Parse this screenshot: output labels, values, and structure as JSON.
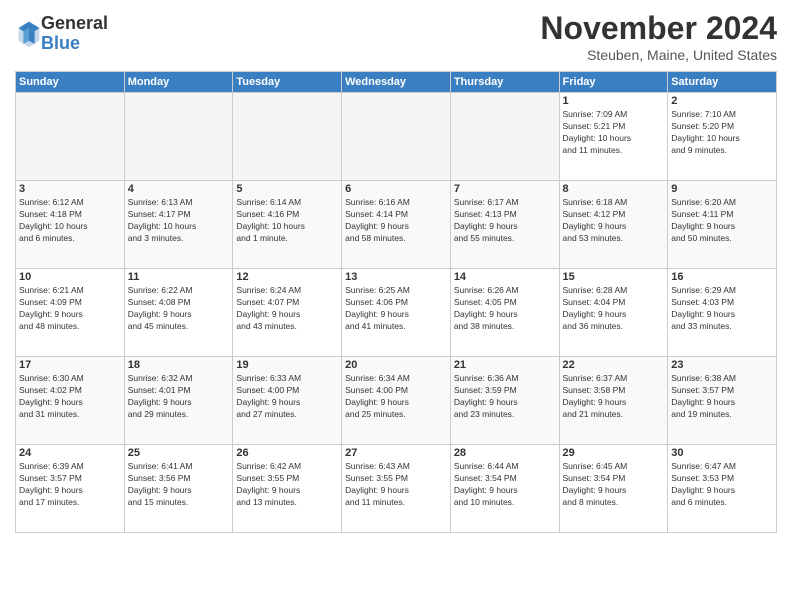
{
  "logo": {
    "general": "General",
    "blue": "Blue"
  },
  "title": "November 2024",
  "location": "Steuben, Maine, United States",
  "days_header": [
    "Sunday",
    "Monday",
    "Tuesday",
    "Wednesday",
    "Thursday",
    "Friday",
    "Saturday"
  ],
  "weeks": [
    [
      {
        "day": "",
        "info": ""
      },
      {
        "day": "",
        "info": ""
      },
      {
        "day": "",
        "info": ""
      },
      {
        "day": "",
        "info": ""
      },
      {
        "day": "",
        "info": ""
      },
      {
        "day": "1",
        "info": "Sunrise: 7:09 AM\nSunset: 5:21 PM\nDaylight: 10 hours\nand 11 minutes."
      },
      {
        "day": "2",
        "info": "Sunrise: 7:10 AM\nSunset: 5:20 PM\nDaylight: 10 hours\nand 9 minutes."
      }
    ],
    [
      {
        "day": "3",
        "info": "Sunrise: 6:12 AM\nSunset: 4:18 PM\nDaylight: 10 hours\nand 6 minutes."
      },
      {
        "day": "4",
        "info": "Sunrise: 6:13 AM\nSunset: 4:17 PM\nDaylight: 10 hours\nand 3 minutes."
      },
      {
        "day": "5",
        "info": "Sunrise: 6:14 AM\nSunset: 4:16 PM\nDaylight: 10 hours\nand 1 minute."
      },
      {
        "day": "6",
        "info": "Sunrise: 6:16 AM\nSunset: 4:14 PM\nDaylight: 9 hours\nand 58 minutes."
      },
      {
        "day": "7",
        "info": "Sunrise: 6:17 AM\nSunset: 4:13 PM\nDaylight: 9 hours\nand 55 minutes."
      },
      {
        "day": "8",
        "info": "Sunrise: 6:18 AM\nSunset: 4:12 PM\nDaylight: 9 hours\nand 53 minutes."
      },
      {
        "day": "9",
        "info": "Sunrise: 6:20 AM\nSunset: 4:11 PM\nDaylight: 9 hours\nand 50 minutes."
      }
    ],
    [
      {
        "day": "10",
        "info": "Sunrise: 6:21 AM\nSunset: 4:09 PM\nDaylight: 9 hours\nand 48 minutes."
      },
      {
        "day": "11",
        "info": "Sunrise: 6:22 AM\nSunset: 4:08 PM\nDaylight: 9 hours\nand 45 minutes."
      },
      {
        "day": "12",
        "info": "Sunrise: 6:24 AM\nSunset: 4:07 PM\nDaylight: 9 hours\nand 43 minutes."
      },
      {
        "day": "13",
        "info": "Sunrise: 6:25 AM\nSunset: 4:06 PM\nDaylight: 9 hours\nand 41 minutes."
      },
      {
        "day": "14",
        "info": "Sunrise: 6:26 AM\nSunset: 4:05 PM\nDaylight: 9 hours\nand 38 minutes."
      },
      {
        "day": "15",
        "info": "Sunrise: 6:28 AM\nSunset: 4:04 PM\nDaylight: 9 hours\nand 36 minutes."
      },
      {
        "day": "16",
        "info": "Sunrise: 6:29 AM\nSunset: 4:03 PM\nDaylight: 9 hours\nand 33 minutes."
      }
    ],
    [
      {
        "day": "17",
        "info": "Sunrise: 6:30 AM\nSunset: 4:02 PM\nDaylight: 9 hours\nand 31 minutes."
      },
      {
        "day": "18",
        "info": "Sunrise: 6:32 AM\nSunset: 4:01 PM\nDaylight: 9 hours\nand 29 minutes."
      },
      {
        "day": "19",
        "info": "Sunrise: 6:33 AM\nSunset: 4:00 PM\nDaylight: 9 hours\nand 27 minutes."
      },
      {
        "day": "20",
        "info": "Sunrise: 6:34 AM\nSunset: 4:00 PM\nDaylight: 9 hours\nand 25 minutes."
      },
      {
        "day": "21",
        "info": "Sunrise: 6:36 AM\nSunset: 3:59 PM\nDaylight: 9 hours\nand 23 minutes."
      },
      {
        "day": "22",
        "info": "Sunrise: 6:37 AM\nSunset: 3:58 PM\nDaylight: 9 hours\nand 21 minutes."
      },
      {
        "day": "23",
        "info": "Sunrise: 6:38 AM\nSunset: 3:57 PM\nDaylight: 9 hours\nand 19 minutes."
      }
    ],
    [
      {
        "day": "24",
        "info": "Sunrise: 6:39 AM\nSunset: 3:57 PM\nDaylight: 9 hours\nand 17 minutes."
      },
      {
        "day": "25",
        "info": "Sunrise: 6:41 AM\nSunset: 3:56 PM\nDaylight: 9 hours\nand 15 minutes."
      },
      {
        "day": "26",
        "info": "Sunrise: 6:42 AM\nSunset: 3:55 PM\nDaylight: 9 hours\nand 13 minutes."
      },
      {
        "day": "27",
        "info": "Sunrise: 6:43 AM\nSunset: 3:55 PM\nDaylight: 9 hours\nand 11 minutes."
      },
      {
        "day": "28",
        "info": "Sunrise: 6:44 AM\nSunset: 3:54 PM\nDaylight: 9 hours\nand 10 minutes."
      },
      {
        "day": "29",
        "info": "Sunrise: 6:45 AM\nSunset: 3:54 PM\nDaylight: 9 hours\nand 8 minutes."
      },
      {
        "day": "30",
        "info": "Sunrise: 6:47 AM\nSunset: 3:53 PM\nDaylight: 9 hours\nand 6 minutes."
      }
    ]
  ]
}
